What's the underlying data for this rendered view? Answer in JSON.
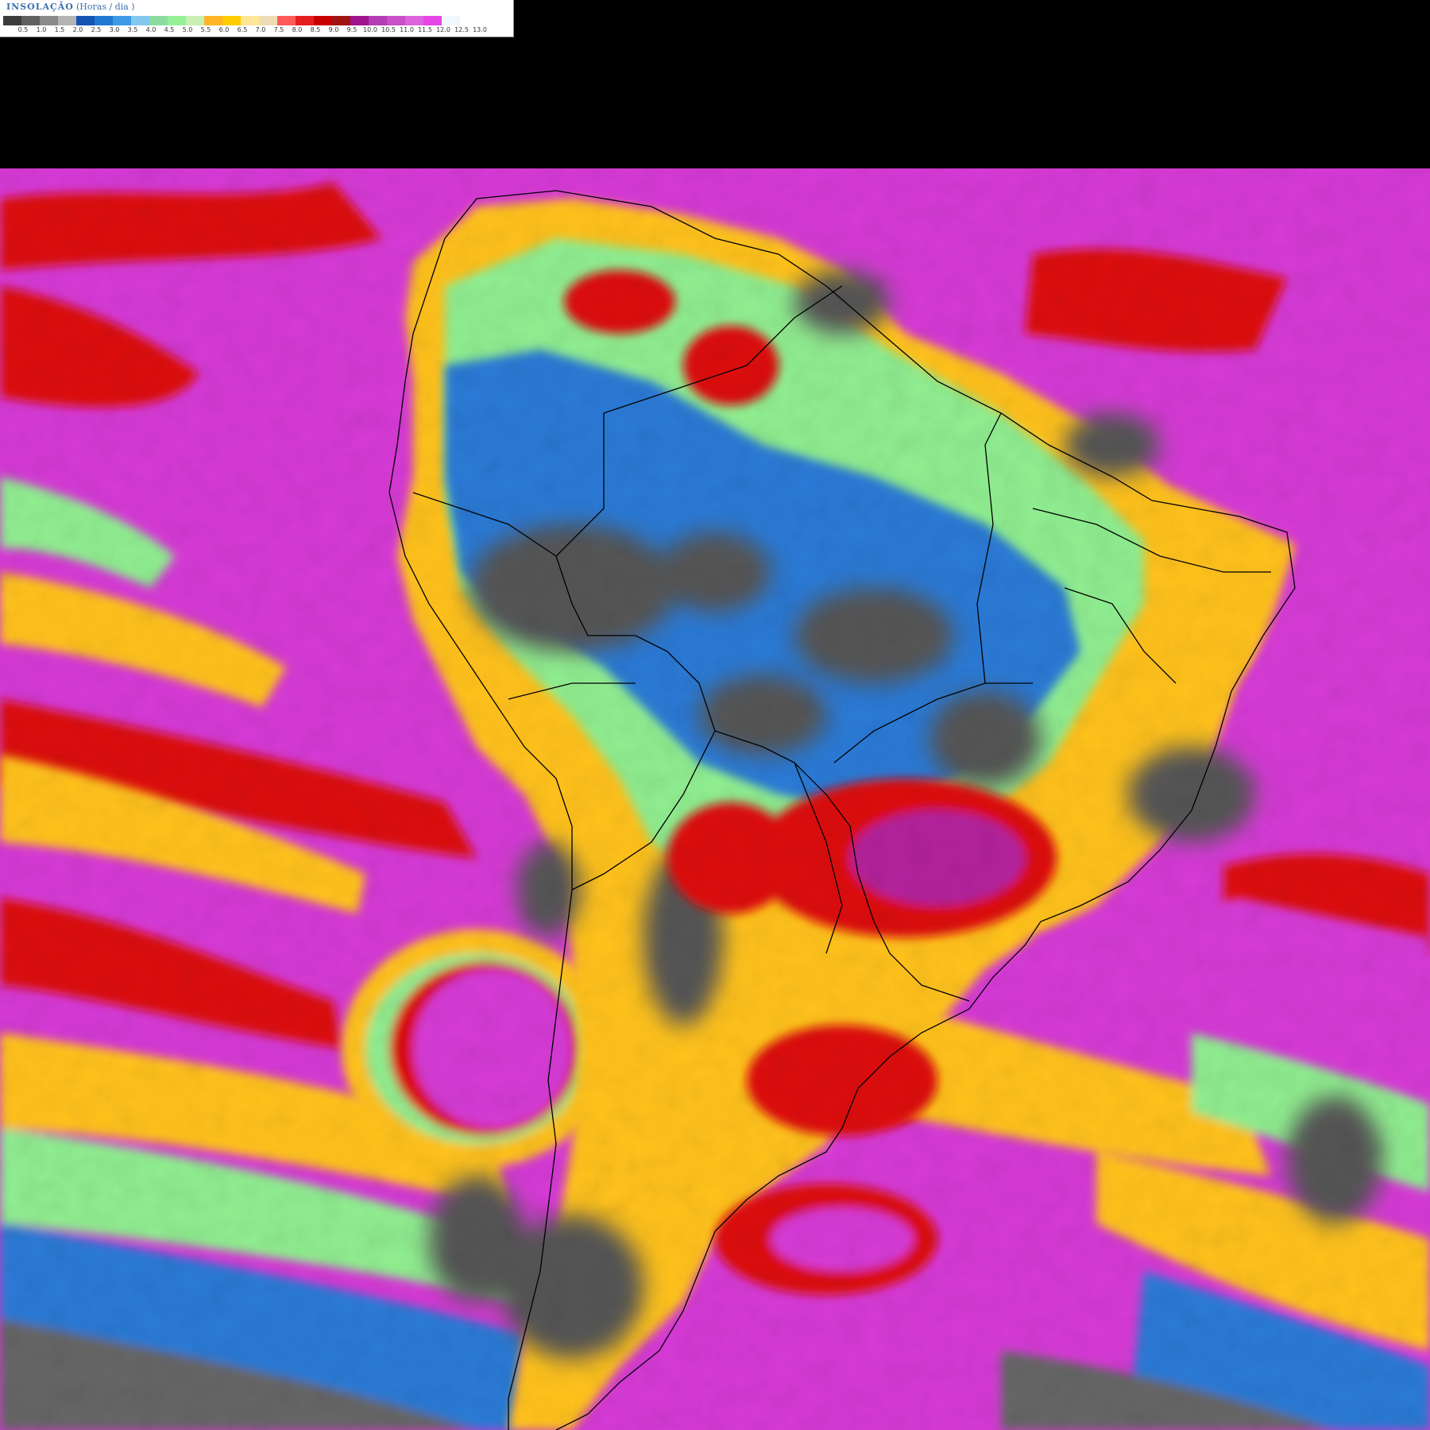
{
  "legend": {
    "title": "INSOLAÇÃO",
    "units": "(Horas / dia )",
    "colors": [
      "#3c3c3c",
      "#606060",
      "#8a8a8a",
      "#b4b4b4",
      "#1455b4",
      "#2078d2",
      "#3c9ae6",
      "#82c8f0",
      "#8cdca0",
      "#96f096",
      "#c8f0b4",
      "#ffb428",
      "#ffcc00",
      "#ffe696",
      "#f0dcb4",
      "#ff5a5a",
      "#e61e1e",
      "#c80000",
      "#a01414",
      "#a0148c",
      "#b43cb4",
      "#c850c8",
      "#dc64dc",
      "#e646e6",
      "#f0f8ff",
      "#ffffff"
    ],
    "ticks": [
      "0.5",
      "1.0",
      "1.5",
      "2.0",
      "2.5",
      "3.0",
      "3.5",
      "4.0",
      "4.5",
      "5.0",
      "5.5",
      "6.0",
      "6.5",
      "7.0",
      "7.5",
      "8.0",
      "8.5",
      "9.0",
      "9.5",
      "10.0",
      "10.5",
      "11.0",
      "11.5",
      "12.0",
      "12.5",
      "13.0"
    ]
  },
  "map": {
    "palette": {
      "ocean_high": "#cc44cc",
      "ocean_mid": "#dd1111",
      "cloud_low": "#555555",
      "cloud_blue": "#2a7ad6",
      "cloud_green": "#90ee90",
      "sun_yellow": "#ffc21c",
      "border": "#000000"
    }
  }
}
